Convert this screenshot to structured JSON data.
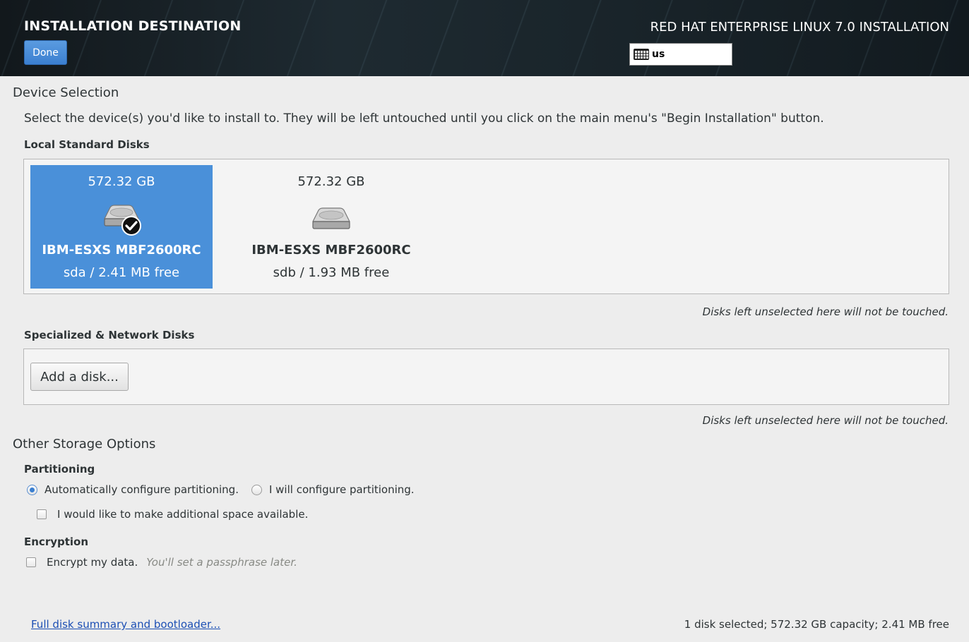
{
  "header": {
    "title": "INSTALLATION DESTINATION",
    "done_label": "Done",
    "product": "RED HAT ENTERPRISE LINUX 7.0 INSTALLATION",
    "keyboard_layout": "us"
  },
  "device_selection": {
    "title": "Device Selection",
    "description": "Select the device(s) you'd like to install to.  They will be left untouched until you click on the main menu's \"Begin Installation\" button.",
    "local_title": "Local Standard Disks",
    "disks": [
      {
        "size": "572.32 GB",
        "model": "IBM-ESXS MBF2600RC",
        "info": "sda  /  2.41 MB free",
        "selected": true
      },
      {
        "size": "572.32 GB",
        "model": "IBM-ESXS MBF2600RC",
        "info": "sdb  /  1.93 MB free",
        "selected": false
      }
    ],
    "local_note": "Disks left unselected here will not be touched.",
    "network_title": "Specialized & Network Disks",
    "add_disk_label": "Add a disk...",
    "network_note": "Disks left unselected here will not be touched."
  },
  "other_options": {
    "title": "Other Storage Options",
    "partitioning_title": "Partitioning",
    "auto_label": "Automatically configure partitioning.",
    "manual_label": "I will configure partitioning.",
    "selected_partitioning": "auto",
    "additional_space_label": "I would like to make additional space available.",
    "encryption_title": "Encryption",
    "encrypt_label": "Encrypt my data.",
    "encrypt_hint": "You'll set a passphrase later."
  },
  "footer": {
    "summary_link": "Full disk summary and bootloader...",
    "status": "1 disk selected; 572.32 GB capacity; 2.41 MB free"
  },
  "colors": {
    "selection": "#4a90d9",
    "link": "#1c4fb4",
    "header_bg": "#1a252b"
  }
}
